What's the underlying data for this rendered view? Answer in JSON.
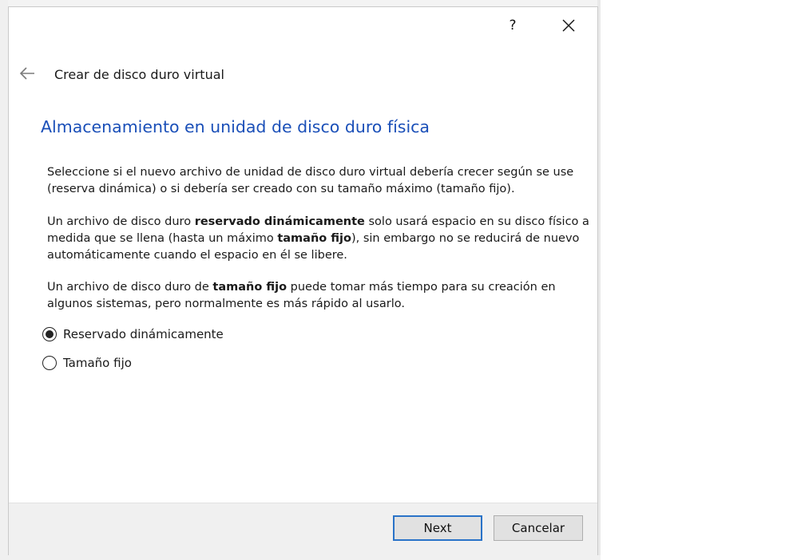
{
  "titlebar": {
    "help_label": "?",
    "close_label": "✕"
  },
  "header": {
    "title": "Crear de disco duro virtual"
  },
  "section": {
    "title": "Almacenamiento en unidad de disco duro física"
  },
  "description": {
    "p1": "Seleccione si el nuevo archivo de unidad de disco duro virtual debería crecer según se use (reserva dinámica) o si debería ser creado con su tamaño máximo (tamaño fijo).",
    "p2_before": "Un archivo de disco duro ",
    "p2_bold1": "reservado dinámicamente",
    "p2_mid": " solo usará espacio en su disco físico a medida que se llena (hasta un máximo ",
    "p2_bold2": "tamaño fijo",
    "p2_after": "), sin embargo no se reducirá de nuevo automáticamente cuando el espacio en él se libere.",
    "p3_before": "Un archivo de disco duro de ",
    "p3_bold": "tamaño fijo",
    "p3_after": " puede tomar más tiempo para su creación en algunos sistemas, pero normalmente es más rápido al usarlo."
  },
  "options": [
    {
      "label": "Reservado dinámicamente",
      "selected": true
    },
    {
      "label": "Tamaño fijo",
      "selected": false
    }
  ],
  "buttons": {
    "next": "Next",
    "cancel": "Cancelar"
  },
  "colors": {
    "section_title": "#1a4fb8",
    "default_button_border": "#2a73c8",
    "footer_bg": "#f0f0f0"
  }
}
